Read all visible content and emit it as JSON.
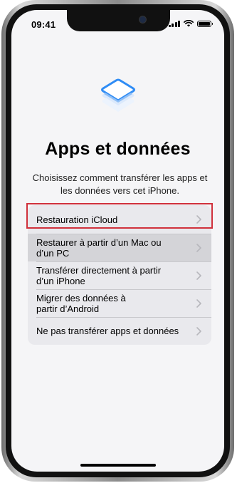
{
  "status_bar": {
    "time": "09:41"
  },
  "header": {
    "icon": "apps-layers-icon",
    "title": "Apps et données",
    "subtitle_line1": "Choisissez comment transférer les apps et",
    "subtitle_line2": "les données vers cet iPhone."
  },
  "options": [
    {
      "line1": "Restauration iCloud",
      "line2": "",
      "selected": true
    },
    {
      "line1": "Restaurer à partir d’un Mac ou",
      "line2": "d’un PC",
      "highlighted": true
    },
    {
      "line1": "Transférer directement à partir",
      "line2": "d’un iPhone"
    },
    {
      "line1": "Migrer des données à",
      "line2": "partir d’Android"
    },
    {
      "line1": "Ne pas transférer apps et données",
      "line2": ""
    }
  ],
  "colors": {
    "accent": "#2f8cf5",
    "highlight_box": "#d0313c"
  }
}
